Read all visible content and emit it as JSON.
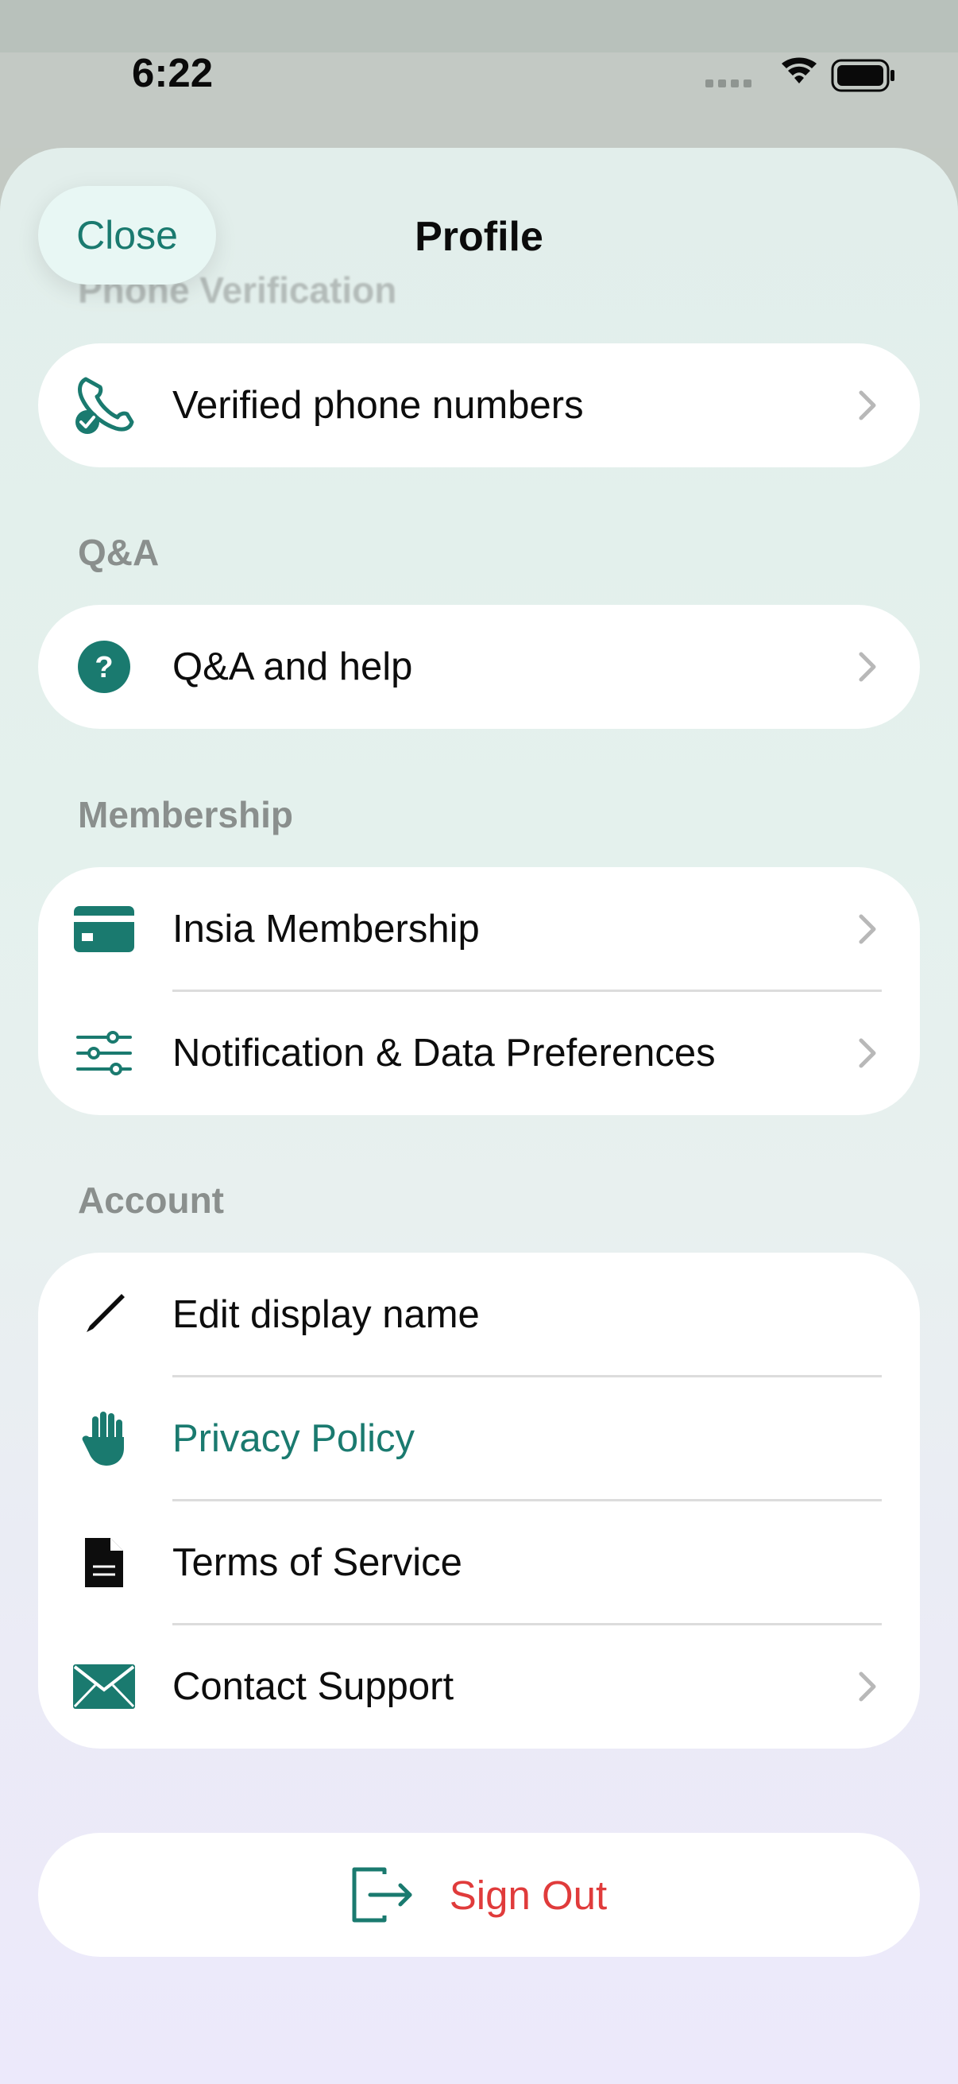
{
  "status_bar": {
    "time": "6:22"
  },
  "header": {
    "close_label": "Close",
    "title": "Profile"
  },
  "scrolled_section_label": "Phone Verification",
  "sections": {
    "phone": {
      "items": [
        {
          "label": "Verified phone numbers",
          "icon": "phone-check-icon"
        }
      ]
    },
    "qa": {
      "header": "Q&A",
      "items": [
        {
          "label": "Q&A and help",
          "icon": "question-circle-icon"
        }
      ]
    },
    "membership": {
      "header": "Membership",
      "items": [
        {
          "label": "Insia Membership",
          "icon": "credit-card-icon"
        },
        {
          "label": "Notification & Data Preferences",
          "icon": "sliders-icon"
        }
      ]
    },
    "account": {
      "header": "Account",
      "items": [
        {
          "label": "Edit display name",
          "icon": "pencil-icon"
        },
        {
          "label": "Privacy Policy",
          "icon": "hand-icon"
        },
        {
          "label": "Terms of Service",
          "icon": "document-icon"
        },
        {
          "label": "Contact Support",
          "icon": "envelope-icon"
        }
      ]
    }
  },
  "sign_out_label": "Sign Out",
  "colors": {
    "accent": "#1a7a6f",
    "danger": "#e03b3b",
    "section_label": "#8a8f8d"
  }
}
